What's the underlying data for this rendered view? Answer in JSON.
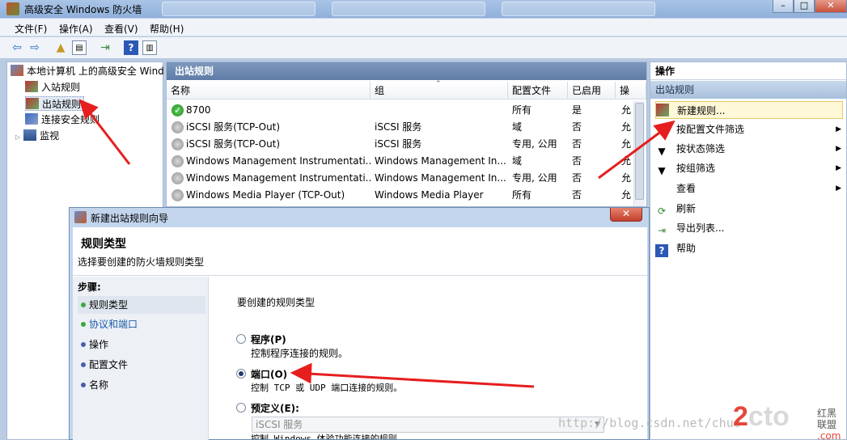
{
  "window": {
    "title": "高级安全 Windows 防火墙"
  },
  "menu": [
    "文件(F)",
    "操作(A)",
    "查看(V)",
    "帮助(H)"
  ],
  "tree": {
    "root": "本地计算机 上的高级安全 Wind",
    "items": [
      "入站规则",
      "出站规则",
      "连接安全规则",
      "监视"
    ]
  },
  "center": {
    "header": "出站规则",
    "columns": [
      "名称",
      "组",
      "配置文件",
      "已启用",
      "操"
    ],
    "rows": [
      {
        "name": "8700",
        "group": "",
        "profile": "所有",
        "enabled": "是",
        "action": "允",
        "status": "green"
      },
      {
        "name": "iSCSI 服务(TCP-Out)",
        "group": "iSCSI 服务",
        "profile": "域",
        "enabled": "否",
        "action": "允",
        "status": "gray"
      },
      {
        "name": "iSCSI 服务(TCP-Out)",
        "group": "iSCSI 服务",
        "profile": "专用, 公用",
        "enabled": "否",
        "action": "允",
        "status": "gray"
      },
      {
        "name": "Windows Management Instrumentati...",
        "group": "Windows Management In...",
        "profile": "域",
        "enabled": "否",
        "action": "允",
        "status": "gray"
      },
      {
        "name": "Windows Management Instrumentati...",
        "group": "Windows Management In...",
        "profile": "专用, 公用",
        "enabled": "否",
        "action": "允",
        "status": "gray"
      },
      {
        "name": "Windows Media Player (TCP-Out)",
        "group": "Windows Media Player",
        "profile": "所有",
        "enabled": "否",
        "action": "允",
        "status": "gray"
      }
    ]
  },
  "actions": {
    "header": "操作",
    "section": "出站规则",
    "items": [
      "新建规则...",
      "按配置文件筛选",
      "按状态筛选",
      "按组筛选",
      "查看",
      "刷新",
      "导出列表...",
      "帮助"
    ]
  },
  "wizard": {
    "title": "新建出站规则向导",
    "close": "✕",
    "heading": "规则类型",
    "subheading": "选择要创建的防火墙规则类型",
    "steps_label": "步骤:",
    "steps": [
      "规则类型",
      "协议和端口",
      "操作",
      "配置文件",
      "名称"
    ],
    "prompt": "要创建的规则类型",
    "options": [
      {
        "label": "程序(P)",
        "desc": "控制程序连接的规则。"
      },
      {
        "label": "端口(O)",
        "desc": "控制 TCP 或 UDP 端口连接的规则。"
      },
      {
        "label": "预定义(E):",
        "desc": "控制 Windows 体验功能连接的规则。"
      }
    ],
    "predefined_value": "iSCSI 服务"
  },
  "watermark": {
    "url": "http://blog.csdn.net/chuo",
    "logo_a": "2",
    "logo_b": "cto",
    "logo_side": "红黑联盟",
    "logo_sub": ".com"
  },
  "colors": {
    "accent": "#e61e1e",
    "title": "#8fb0da"
  }
}
